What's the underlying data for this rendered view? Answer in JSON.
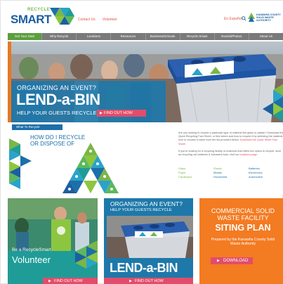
{
  "header": {
    "logo_top": "RECYCLE",
    "logo_main": "SMART",
    "links": [
      "Contact Us",
      "Volunteer"
    ],
    "search_label": "En Español",
    "partner": "KANAWHA COUNTY SOLID WASTE AUTHORITY"
  },
  "nav": {
    "items": [
      "Get Your Start",
      "Why Recycle",
      "Locations",
      "Resources",
      "Business/Schools",
      "Recycle Smart",
      "Events/Photos",
      "About Us"
    ]
  },
  "hero": {
    "organize": "ORGANIZING AN EVENT?",
    "title": "LEND-a-BIN",
    "subtitle": "HELP YOUR GUESTS RECYCLE",
    "button": "FIND OUT HOW"
  },
  "what_to_recycle": {
    "tab": "What To Recycle",
    "heading_line1": "HOW DO I RECYCLE",
    "heading_line2": "OR DISPOSE OF",
    "paragraph1": "Are you looking to recycle a particular type of material like glass or plastic? Download the Quick Recycling Fact Sheet, or find where and how to recycle it by selecting the material icon or choose a name from the list provided below.",
    "paragraph1_link": "Download the Quick Sheet Fact Sheet",
    "paragraph2": "If you're looking for a recycling facility or business that offers the option to recycle, such as recycling car batteries & Kanawha Auto, visit our",
    "paragraph2_link": "locations page.",
    "categories": [
      {
        "label": "Glass",
        "color": "#7ab648"
      },
      {
        "label": "Plastic",
        "color": "#7ab648"
      },
      {
        "label": "Batteries",
        "color": "#1c6fa8"
      },
      {
        "label": "Paper",
        "color": "#7ab648"
      },
      {
        "label": "Metals",
        "color": "#1c6fa8"
      },
      {
        "label": "Electronics",
        "color": "#1c6fa8"
      },
      {
        "label": "Cardboard",
        "color": "#7ab648"
      },
      {
        "label": "Household",
        "color": "#1c6fa8"
      },
      {
        "label": "Automotive",
        "color": "#1c6fa8"
      }
    ]
  },
  "cards": {
    "volunteer": {
      "small": "Be a RecycleSmart",
      "big": "Volunteer",
      "button": "FIND OUT HOW"
    },
    "lend": {
      "organize": "ORGANIZING AN EVENT?",
      "help": "HELP YOUR GUESTS RECYCLE",
      "title": "LEND-a-BIN",
      "button": "FIND OUT HOW"
    },
    "siting": {
      "top": "COMMERCIAL SOLID WASTE FACILITY",
      "big": "SITING PLAN",
      "desc": "Prepared by the Kanawha County Solid Waste Authority",
      "button": "DOWNLOAD"
    }
  },
  "colors": {
    "brand_blue": "#1c6fa8",
    "brand_green": "#7ab648",
    "accent_pink": "#e14d6a",
    "teal": "#1f9c98",
    "orange": "#f37b22"
  }
}
